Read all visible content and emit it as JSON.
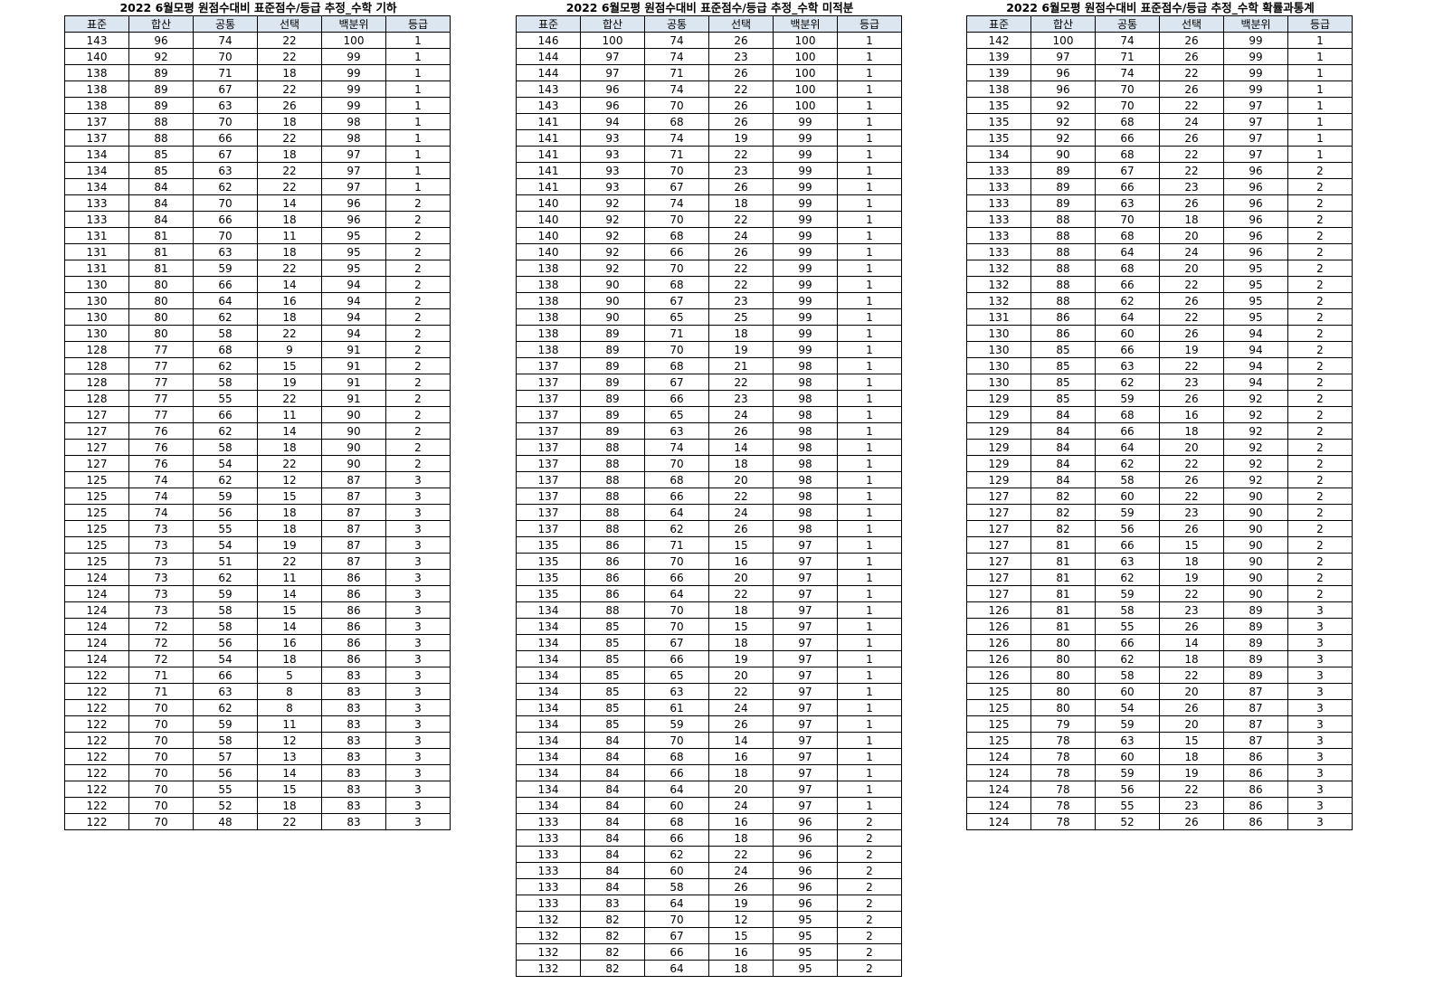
{
  "headers": [
    "표준",
    "합산",
    "공통",
    "선택",
    "백분위",
    "등급"
  ],
  "tables": [
    {
      "title": "2022 6월모평 원점수대비 표준점수/등급 추정_수학 기하",
      "rows": [
        [
          "143",
          "96",
          "74",
          "22",
          "100",
          "1"
        ],
        [
          "140",
          "92",
          "70",
          "22",
          "99",
          "1"
        ],
        [
          "138",
          "89",
          "71",
          "18",
          "99",
          "1"
        ],
        [
          "138",
          "89",
          "67",
          "22",
          "99",
          "1"
        ],
        [
          "138",
          "89",
          "63",
          "26",
          "99",
          "1"
        ],
        [
          "137",
          "88",
          "70",
          "18",
          "98",
          "1"
        ],
        [
          "137",
          "88",
          "66",
          "22",
          "98",
          "1"
        ],
        [
          "134",
          "85",
          "67",
          "18",
          "97",
          "1"
        ],
        [
          "134",
          "85",
          "63",
          "22",
          "97",
          "1"
        ],
        [
          "134",
          "84",
          "62",
          "22",
          "97",
          "1"
        ],
        [
          "133",
          "84",
          "70",
          "14",
          "96",
          "2"
        ],
        [
          "133",
          "84",
          "66",
          "18",
          "96",
          "2"
        ],
        [
          "131",
          "81",
          "70",
          "11",
          "95",
          "2"
        ],
        [
          "131",
          "81",
          "63",
          "18",
          "95",
          "2"
        ],
        [
          "131",
          "81",
          "59",
          "22",
          "95",
          "2"
        ],
        [
          "130",
          "80",
          "66",
          "14",
          "94",
          "2"
        ],
        [
          "130",
          "80",
          "64",
          "16",
          "94",
          "2"
        ],
        [
          "130",
          "80",
          "62",
          "18",
          "94",
          "2"
        ],
        [
          "130",
          "80",
          "58",
          "22",
          "94",
          "2"
        ],
        [
          "128",
          "77",
          "68",
          "9",
          "91",
          "2"
        ],
        [
          "128",
          "77",
          "62",
          "15",
          "91",
          "2"
        ],
        [
          "128",
          "77",
          "58",
          "19",
          "91",
          "2"
        ],
        [
          "128",
          "77",
          "55",
          "22",
          "91",
          "2"
        ],
        [
          "127",
          "77",
          "66",
          "11",
          "90",
          "2"
        ],
        [
          "127",
          "76",
          "62",
          "14",
          "90",
          "2"
        ],
        [
          "127",
          "76",
          "58",
          "18",
          "90",
          "2"
        ],
        [
          "127",
          "76",
          "54",
          "22",
          "90",
          "2"
        ],
        [
          "125",
          "74",
          "62",
          "12",
          "87",
          "3"
        ],
        [
          "125",
          "74",
          "59",
          "15",
          "87",
          "3"
        ],
        [
          "125",
          "74",
          "56",
          "18",
          "87",
          "3"
        ],
        [
          "125",
          "73",
          "55",
          "18",
          "87",
          "3"
        ],
        [
          "125",
          "73",
          "54",
          "19",
          "87",
          "3"
        ],
        [
          "125",
          "73",
          "51",
          "22",
          "87",
          "3"
        ],
        [
          "124",
          "73",
          "62",
          "11",
          "86",
          "3"
        ],
        [
          "124",
          "73",
          "59",
          "14",
          "86",
          "3"
        ],
        [
          "124",
          "73",
          "58",
          "15",
          "86",
          "3"
        ],
        [
          "124",
          "72",
          "58",
          "14",
          "86",
          "3"
        ],
        [
          "124",
          "72",
          "56",
          "16",
          "86",
          "3"
        ],
        [
          "124",
          "72",
          "54",
          "18",
          "86",
          "3"
        ],
        [
          "122",
          "71",
          "66",
          "5",
          "83",
          "3"
        ],
        [
          "122",
          "71",
          "63",
          "8",
          "83",
          "3"
        ],
        [
          "122",
          "70",
          "62",
          "8",
          "83",
          "3"
        ],
        [
          "122",
          "70",
          "59",
          "11",
          "83",
          "3"
        ],
        [
          "122",
          "70",
          "58",
          "12",
          "83",
          "3"
        ],
        [
          "122",
          "70",
          "57",
          "13",
          "83",
          "3"
        ],
        [
          "122",
          "70",
          "56",
          "14",
          "83",
          "3"
        ],
        [
          "122",
          "70",
          "55",
          "15",
          "83",
          "3"
        ],
        [
          "122",
          "70",
          "52",
          "18",
          "83",
          "3"
        ],
        [
          "122",
          "70",
          "48",
          "22",
          "83",
          "3"
        ]
      ]
    },
    {
      "title": "2022 6월모평 원점수대비 표준점수/등급 추정_수학 미적분",
      "rows": [
        [
          "146",
          "100",
          "74",
          "26",
          "100",
          "1"
        ],
        [
          "144",
          "97",
          "74",
          "23",
          "100",
          "1"
        ],
        [
          "144",
          "97",
          "71",
          "26",
          "100",
          "1"
        ],
        [
          "143",
          "96",
          "74",
          "22",
          "100",
          "1"
        ],
        [
          "143",
          "96",
          "70",
          "26",
          "100",
          "1"
        ],
        [
          "141",
          "94",
          "68",
          "26",
          "99",
          "1"
        ],
        [
          "141",
          "93",
          "74",
          "19",
          "99",
          "1"
        ],
        [
          "141",
          "93",
          "71",
          "22",
          "99",
          "1"
        ],
        [
          "141",
          "93",
          "70",
          "23",
          "99",
          "1"
        ],
        [
          "141",
          "93",
          "67",
          "26",
          "99",
          "1"
        ],
        [
          "140",
          "92",
          "74",
          "18",
          "99",
          "1"
        ],
        [
          "140",
          "92",
          "70",
          "22",
          "99",
          "1"
        ],
        [
          "140",
          "92",
          "68",
          "24",
          "99",
          "1"
        ],
        [
          "140",
          "92",
          "66",
          "26",
          "99",
          "1"
        ],
        [
          "138",
          "92",
          "70",
          "22",
          "99",
          "1"
        ],
        [
          "138",
          "90",
          "68",
          "22",
          "99",
          "1"
        ],
        [
          "138",
          "90",
          "67",
          "23",
          "99",
          "1"
        ],
        [
          "138",
          "90",
          "65",
          "25",
          "99",
          "1"
        ],
        [
          "138",
          "89",
          "71",
          "18",
          "99",
          "1"
        ],
        [
          "138",
          "89",
          "70",
          "19",
          "99",
          "1"
        ],
        [
          "137",
          "89",
          "68",
          "21",
          "98",
          "1"
        ],
        [
          "137",
          "89",
          "67",
          "22",
          "98",
          "1"
        ],
        [
          "137",
          "89",
          "66",
          "23",
          "98",
          "1"
        ],
        [
          "137",
          "89",
          "65",
          "24",
          "98",
          "1"
        ],
        [
          "137",
          "89",
          "63",
          "26",
          "98",
          "1"
        ],
        [
          "137",
          "88",
          "74",
          "14",
          "98",
          "1"
        ],
        [
          "137",
          "88",
          "70",
          "18",
          "98",
          "1"
        ],
        [
          "137",
          "88",
          "68",
          "20",
          "98",
          "1"
        ],
        [
          "137",
          "88",
          "66",
          "22",
          "98",
          "1"
        ],
        [
          "137",
          "88",
          "64",
          "24",
          "98",
          "1"
        ],
        [
          "137",
          "88",
          "62",
          "26",
          "98",
          "1"
        ],
        [
          "135",
          "86",
          "71",
          "15",
          "97",
          "1"
        ],
        [
          "135",
          "86",
          "70",
          "16",
          "97",
          "1"
        ],
        [
          "135",
          "86",
          "66",
          "20",
          "97",
          "1"
        ],
        [
          "135",
          "86",
          "64",
          "22",
          "97",
          "1"
        ],
        [
          "134",
          "88",
          "70",
          "18",
          "97",
          "1"
        ],
        [
          "134",
          "85",
          "70",
          "15",
          "97",
          "1"
        ],
        [
          "134",
          "85",
          "67",
          "18",
          "97",
          "1"
        ],
        [
          "134",
          "85",
          "66",
          "19",
          "97",
          "1"
        ],
        [
          "134",
          "85",
          "65",
          "20",
          "97",
          "1"
        ],
        [
          "134",
          "85",
          "63",
          "22",
          "97",
          "1"
        ],
        [
          "134",
          "85",
          "61",
          "24",
          "97",
          "1"
        ],
        [
          "134",
          "85",
          "59",
          "26",
          "97",
          "1"
        ],
        [
          "134",
          "84",
          "70",
          "14",
          "97",
          "1"
        ],
        [
          "134",
          "84",
          "68",
          "16",
          "97",
          "1"
        ],
        [
          "134",
          "84",
          "66",
          "18",
          "97",
          "1"
        ],
        [
          "134",
          "84",
          "64",
          "20",
          "97",
          "1"
        ],
        [
          "134",
          "84",
          "60",
          "24",
          "97",
          "1"
        ],
        [
          "133",
          "84",
          "68",
          "16",
          "96",
          "2"
        ],
        [
          "133",
          "84",
          "66",
          "18",
          "96",
          "2"
        ],
        [
          "133",
          "84",
          "62",
          "22",
          "96",
          "2"
        ],
        [
          "133",
          "84",
          "60",
          "24",
          "96",
          "2"
        ],
        [
          "133",
          "84",
          "58",
          "26",
          "96",
          "2"
        ],
        [
          "133",
          "83",
          "64",
          "19",
          "96",
          "2"
        ],
        [
          "132",
          "82",
          "70",
          "12",
          "95",
          "2"
        ],
        [
          "132",
          "82",
          "67",
          "15",
          "95",
          "2"
        ],
        [
          "132",
          "82",
          "66",
          "16",
          "95",
          "2"
        ],
        [
          "132",
          "82",
          "64",
          "18",
          "95",
          "2"
        ]
      ]
    },
    {
      "title": "2022 6월모평 원점수대비 표준점수/등급 추정_수학 확률과통계",
      "rows": [
        [
          "142",
          "100",
          "74",
          "26",
          "99",
          "1"
        ],
        [
          "139",
          "97",
          "71",
          "26",
          "99",
          "1"
        ],
        [
          "139",
          "96",
          "74",
          "22",
          "99",
          "1"
        ],
        [
          "138",
          "96",
          "70",
          "26",
          "99",
          "1"
        ],
        [
          "135",
          "92",
          "70",
          "22",
          "97",
          "1"
        ],
        [
          "135",
          "92",
          "68",
          "24",
          "97",
          "1"
        ],
        [
          "135",
          "92",
          "66",
          "26",
          "97",
          "1"
        ],
        [
          "134",
          "90",
          "68",
          "22",
          "97",
          "1"
        ],
        [
          "133",
          "89",
          "67",
          "22",
          "96",
          "2"
        ],
        [
          "133",
          "89",
          "66",
          "23",
          "96",
          "2"
        ],
        [
          "133",
          "89",
          "63",
          "26",
          "96",
          "2"
        ],
        [
          "133",
          "88",
          "70",
          "18",
          "96",
          "2"
        ],
        [
          "133",
          "88",
          "68",
          "20",
          "96",
          "2"
        ],
        [
          "133",
          "88",
          "64",
          "24",
          "96",
          "2"
        ],
        [
          "132",
          "88",
          "68",
          "20",
          "95",
          "2"
        ],
        [
          "132",
          "88",
          "66",
          "22",
          "95",
          "2"
        ],
        [
          "132",
          "88",
          "62",
          "26",
          "95",
          "2"
        ],
        [
          "131",
          "86",
          "64",
          "22",
          "95",
          "2"
        ],
        [
          "130",
          "86",
          "60",
          "26",
          "94",
          "2"
        ],
        [
          "130",
          "85",
          "66",
          "19",
          "94",
          "2"
        ],
        [
          "130",
          "85",
          "63",
          "22",
          "94",
          "2"
        ],
        [
          "130",
          "85",
          "62",
          "23",
          "94",
          "2"
        ],
        [
          "129",
          "85",
          "59",
          "26",
          "92",
          "2"
        ],
        [
          "129",
          "84",
          "68",
          "16",
          "92",
          "2"
        ],
        [
          "129",
          "84",
          "66",
          "18",
          "92",
          "2"
        ],
        [
          "129",
          "84",
          "64",
          "20",
          "92",
          "2"
        ],
        [
          "129",
          "84",
          "62",
          "22",
          "92",
          "2"
        ],
        [
          "129",
          "84",
          "58",
          "26",
          "92",
          "2"
        ],
        [
          "127",
          "82",
          "60",
          "22",
          "90",
          "2"
        ],
        [
          "127",
          "82",
          "59",
          "23",
          "90",
          "2"
        ],
        [
          "127",
          "82",
          "56",
          "26",
          "90",
          "2"
        ],
        [
          "127",
          "81",
          "66",
          "15",
          "90",
          "2"
        ],
        [
          "127",
          "81",
          "63",
          "18",
          "90",
          "2"
        ],
        [
          "127",
          "81",
          "62",
          "19",
          "90",
          "2"
        ],
        [
          "127",
          "81",
          "59",
          "22",
          "90",
          "2"
        ],
        [
          "126",
          "81",
          "58",
          "23",
          "89",
          "3"
        ],
        [
          "126",
          "81",
          "55",
          "26",
          "89",
          "3"
        ],
        [
          "126",
          "80",
          "66",
          "14",
          "89",
          "3"
        ],
        [
          "126",
          "80",
          "62",
          "18",
          "89",
          "3"
        ],
        [
          "126",
          "80",
          "58",
          "22",
          "89",
          "3"
        ],
        [
          "125",
          "80",
          "60",
          "20",
          "87",
          "3"
        ],
        [
          "125",
          "80",
          "54",
          "26",
          "87",
          "3"
        ],
        [
          "125",
          "79",
          "59",
          "20",
          "87",
          "3"
        ],
        [
          "125",
          "78",
          "63",
          "15",
          "87",
          "3"
        ],
        [
          "124",
          "78",
          "60",
          "18",
          "86",
          "3"
        ],
        [
          "124",
          "78",
          "59",
          "19",
          "86",
          "3"
        ],
        [
          "124",
          "78",
          "56",
          "22",
          "86",
          "3"
        ],
        [
          "124",
          "78",
          "55",
          "23",
          "86",
          "3"
        ],
        [
          "124",
          "78",
          "52",
          "26",
          "86",
          "3"
        ]
      ]
    }
  ]
}
